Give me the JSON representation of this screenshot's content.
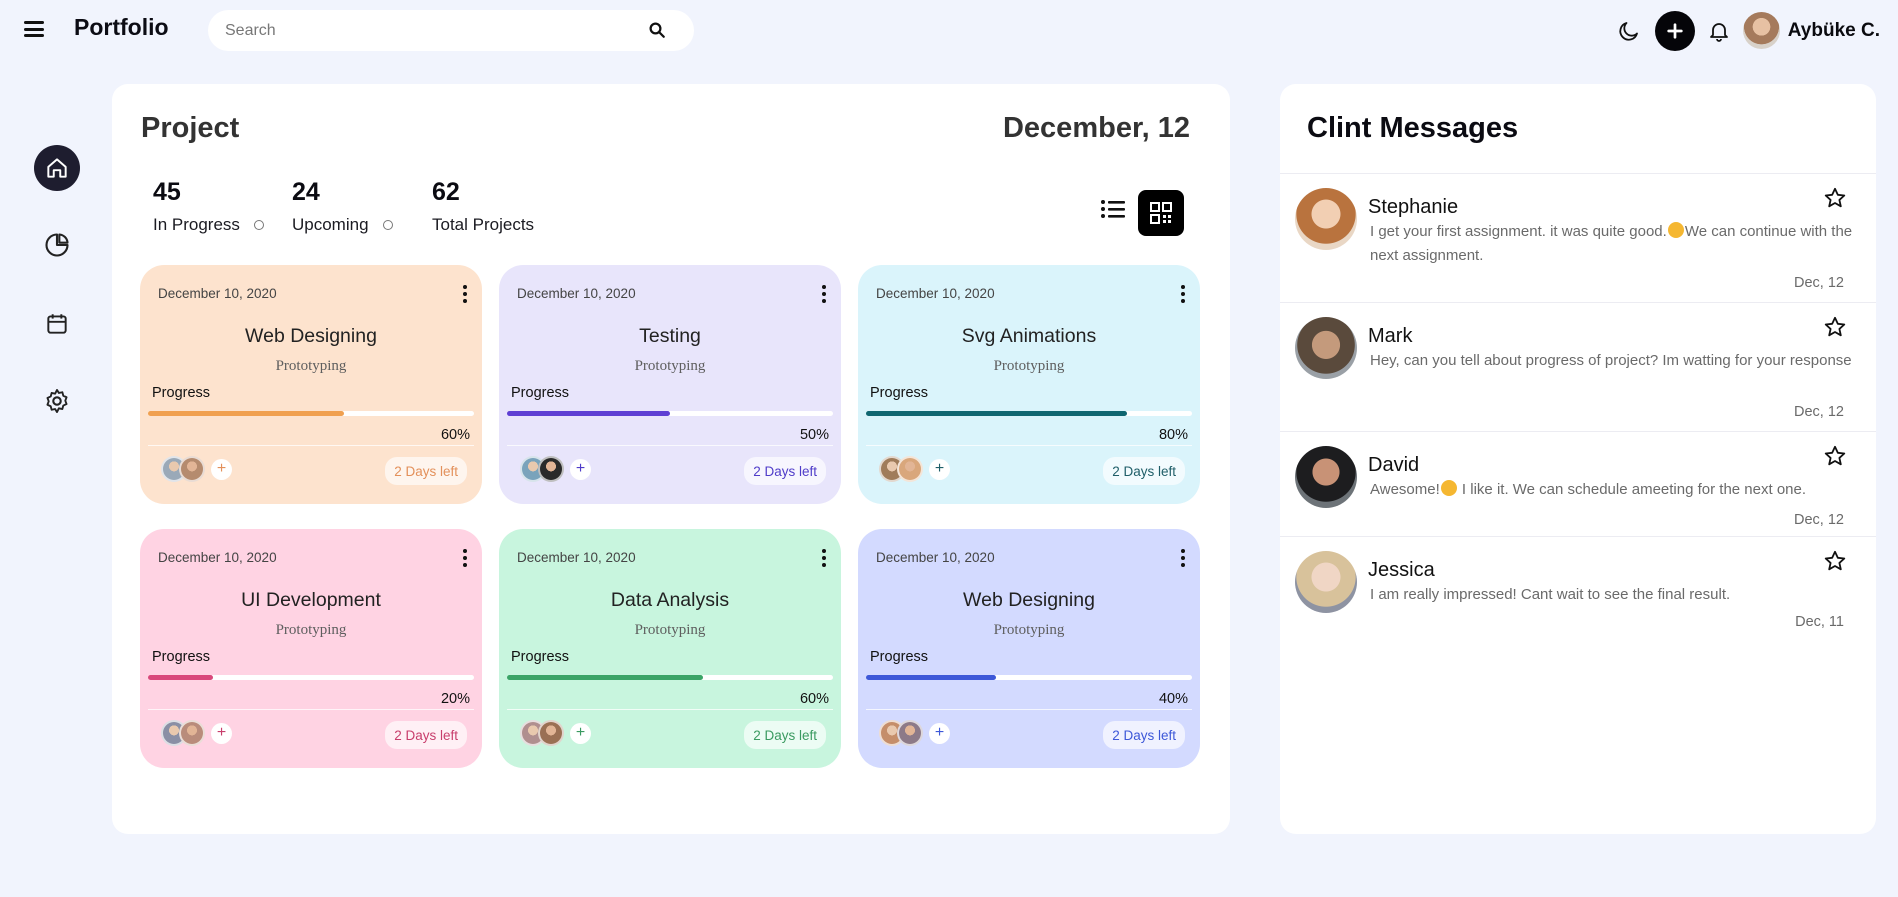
{
  "topbar": {
    "brand": "Portfolio",
    "search_placeholder": "Search",
    "user_name": "Aybüke C."
  },
  "project": {
    "title": "Project",
    "date": "December, 12",
    "stats": [
      {
        "value": "45",
        "label": "In Progress"
      },
      {
        "value": "24",
        "label": "Upcoming"
      },
      {
        "value": "62",
        "label": "Total Projects"
      }
    ],
    "cards": [
      {
        "date": "December 10, 2020",
        "title": "Web Designing",
        "subtitle": "Prototyping",
        "progress_label": "Progress",
        "progress": 60,
        "percent_text": "60%",
        "days_left": "2 Days left",
        "bg": "#fde3ce",
        "accent": "#f0a050",
        "days_color": "#e3905a",
        "add_color": "#e3905a"
      },
      {
        "date": "December 10, 2020",
        "title": "Testing",
        "subtitle": "Prototyping",
        "progress_label": "Progress",
        "progress": 50,
        "percent_text": "50%",
        "days_left": "2 Days left",
        "bg": "#e8e5fb",
        "accent": "#5e3fd3",
        "days_color": "#4f3cc9",
        "add_color": "#4f3cc9"
      },
      {
        "date": "December 10, 2020",
        "title": "Svg Animations",
        "subtitle": "Prototyping",
        "progress_label": "Progress",
        "progress": 80,
        "percent_text": "80%",
        "days_left": "2 Days left",
        "bg": "#daf4fb",
        "accent": "#0f6670",
        "days_color": "#1f5e68",
        "add_color": "#1f5e68"
      },
      {
        "date": "December 10, 2020",
        "title": "UI Development",
        "subtitle": "Prototyping",
        "progress_label": "Progress",
        "progress": 20,
        "percent_text": "20%",
        "days_left": "2 Days left",
        "bg": "#ffd3e3",
        "accent": "#d9487b",
        "days_color": "#c83e6c",
        "add_color": "#c83e6c"
      },
      {
        "date": "December 10, 2020",
        "title": "Data Analysis",
        "subtitle": "Prototyping",
        "progress_label": "Progress",
        "progress": 60,
        "percent_text": "60%",
        "days_left": "2 Days left",
        "bg": "#c8f5de",
        "accent": "#3aa466",
        "days_color": "#3a9a60",
        "add_color": "#3a9a60"
      },
      {
        "date": "December 10, 2020",
        "title": "Web Designing",
        "subtitle": "Prototyping",
        "progress_label": "Progress",
        "progress": 40,
        "percent_text": "40%",
        "days_left": "2 Days left",
        "bg": "#d3daff",
        "accent": "#3d58d8",
        "days_color": "#3d58d8",
        "add_color": "#3d58d8"
      }
    ]
  },
  "messages": {
    "title": "Clint Messages",
    "items": [
      {
        "name": "Stephanie",
        "text_before": "I get your first assignment. it was quite good.",
        "text_after": "We can continue with the next assignment.",
        "time": "Dec, 12"
      },
      {
        "name": "Mark",
        "text_before": "Hey, can you tell about progress of project? Im watting for your response",
        "text_after": "",
        "time": "Dec, 12"
      },
      {
        "name": "David",
        "text_before": "Awesome!",
        "text_after": " I like it. We can schedule ameeting for the next one.",
        "time": "Dec, 12"
      },
      {
        "name": "Jessica",
        "text_before": "I am really impressed! Cant wait to see the final result.",
        "text_after": "",
        "time": "Dec, 11"
      }
    ]
  },
  "colors": {
    "page_bg": "#f1f4fd",
    "panel_bg": "#ffffff",
    "rail_active": "#1e1d2f"
  },
  "icons": [
    "menu-icon",
    "search-icon",
    "moon-icon",
    "plus-icon",
    "bell-icon",
    "home-icon",
    "pie-chart-icon",
    "calendar-icon",
    "settings-icon",
    "list-view-icon",
    "grid-view-icon",
    "kebab-icon",
    "star-icon"
  ]
}
